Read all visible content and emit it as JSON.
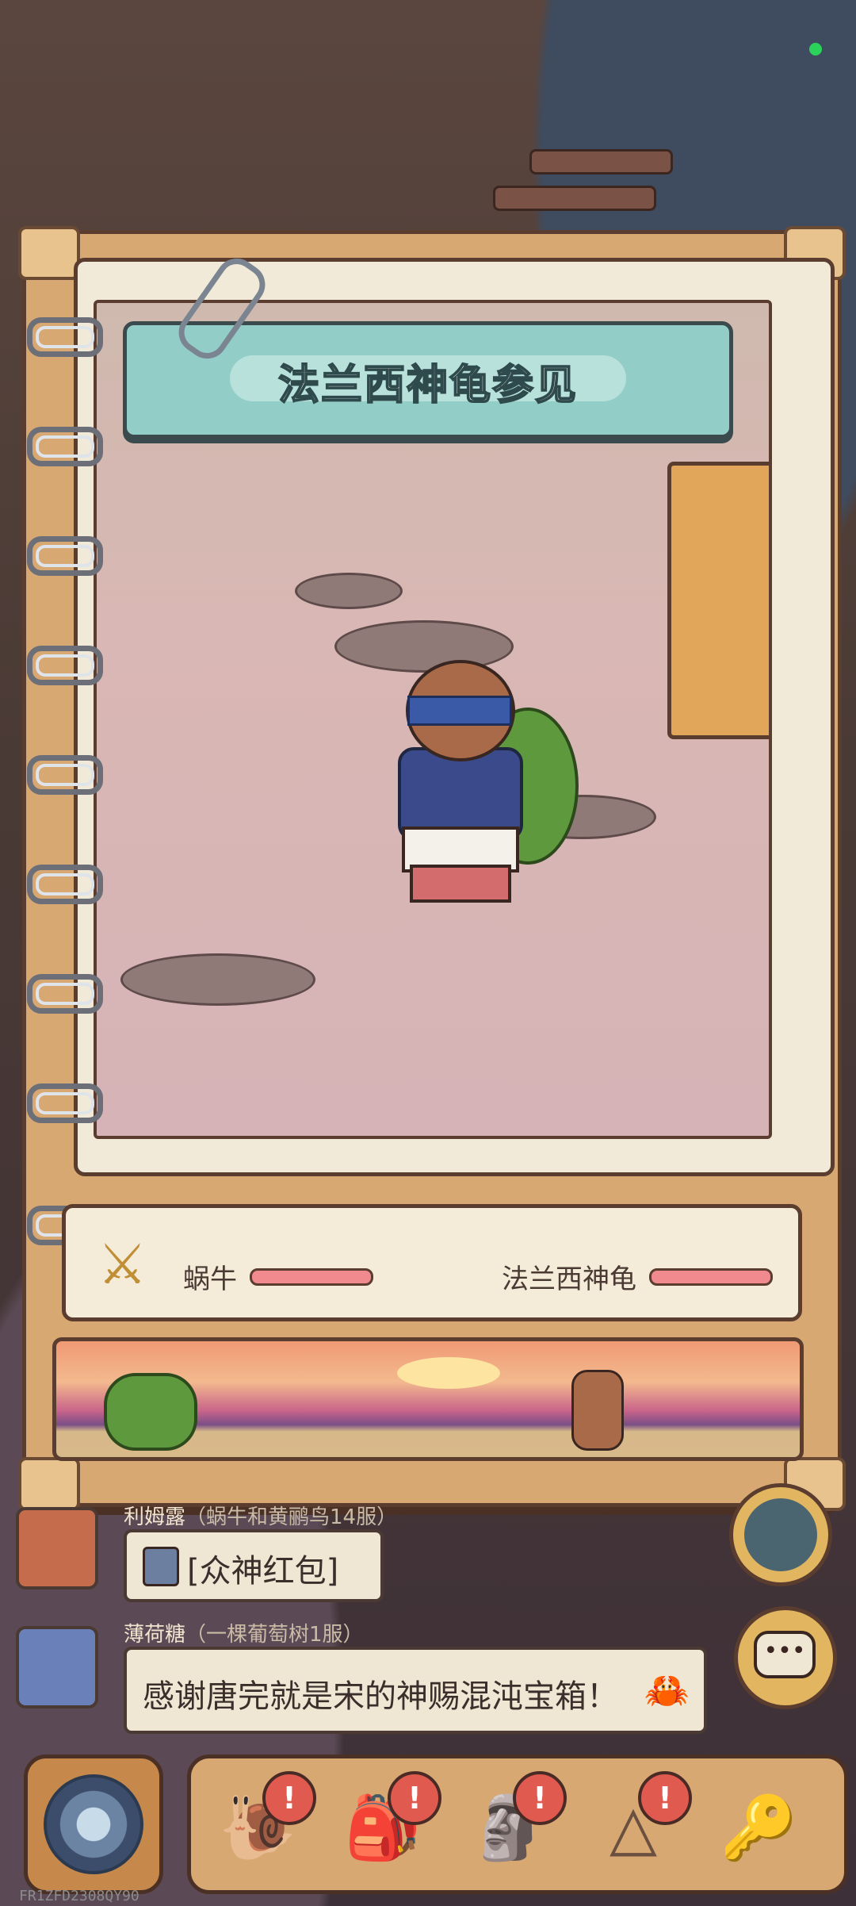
{
  "banner": {
    "title": "法兰西神龟参见"
  },
  "battle": {
    "left_name": "蜗牛",
    "right_name": "法兰西神龟",
    "left_hp_fraction": 1.0,
    "right_hp_fraction": 1.0
  },
  "chat": [
    {
      "name": "利姆露",
      "server": "（蜗牛和黄鹂鸟14服）",
      "message": "[众神红包]"
    },
    {
      "name": "薄荷糖",
      "server": "（一棵葡萄树1服）",
      "message": "感谢唐完就是宋的神赐混沌宝箱！"
    }
  ],
  "bottom_nav": {
    "tabs": [
      {
        "icon": "snail-icon",
        "badge": "!"
      },
      {
        "icon": "backpack-icon",
        "badge": "!"
      },
      {
        "icon": "statue-icon",
        "badge": "!"
      },
      {
        "icon": "pyramid-icon",
        "badge": "!"
      },
      {
        "icon": "key-coin-icon",
        "badge": ""
      }
    ]
  },
  "device_id": "FR1ZFD2308QY90",
  "colors": {
    "hp": "#f08a8f",
    "banner": "#92cdc7",
    "badge": "#e05a4f",
    "status": "#2bd25a"
  }
}
